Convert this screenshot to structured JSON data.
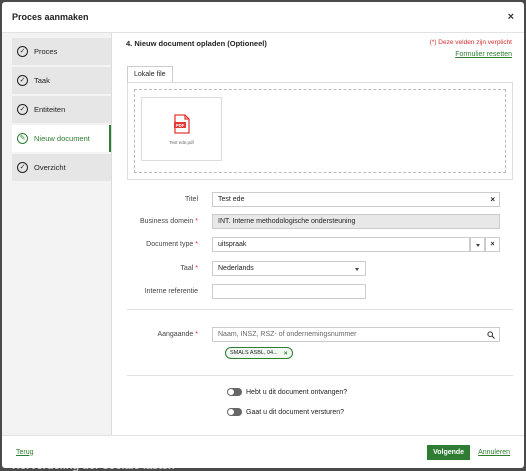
{
  "background": {
    "text": "Herverdeling der sociale lasten"
  },
  "modal": {
    "title": "Proces aanmaken",
    "close_label": "×"
  },
  "sidebar": {
    "items": [
      {
        "label": "Proces",
        "state": "done"
      },
      {
        "label": "Taak",
        "state": "done"
      },
      {
        "label": "Entiteiten",
        "state": "done"
      },
      {
        "label": "Nieuw document",
        "state": "active"
      },
      {
        "label": "Overzicht",
        "state": "done"
      }
    ]
  },
  "section": {
    "title": "4. Nieuw document opladen (Optioneel)",
    "required_note": "(*) Deze velden zijn verplicht",
    "reset_label": "Formulier resetten"
  },
  "upload": {
    "tab_label": "Lokale file",
    "file_name": "Test ede.pdf",
    "file_type": "PDF"
  },
  "form": {
    "titel": {
      "label": "Titel",
      "value": "Test ede",
      "required": false
    },
    "business_domein": {
      "label": "Business domein",
      "value": "INT. Interne methodologische ondersteuning",
      "required": true
    },
    "document_type": {
      "label": "Document type",
      "value": "uitspraak",
      "required": true
    },
    "taal": {
      "label": "Taal",
      "value": "Nederlands",
      "required": true
    },
    "interne_referentie": {
      "label": "Interne referentie",
      "value": "",
      "required": false
    },
    "aangaande": {
      "label": "Aangaande",
      "placeholder": "Naam, INSZ, RSZ- of ondernemingsnummer",
      "required": true,
      "chip": "SMALS ASBL, 04..."
    }
  },
  "toggles": [
    {
      "label": "Hebt u dit document ontvangen?",
      "on": false
    },
    {
      "label": "Gaat u dit document versturen?",
      "on": false
    }
  ],
  "footer": {
    "back_label": "Terug",
    "next_label": "Volgende",
    "cancel_label": "Annuleren"
  },
  "colors": {
    "accent": "#2e7d32",
    "required": "#d32f2f",
    "pdf": "#e53935"
  }
}
